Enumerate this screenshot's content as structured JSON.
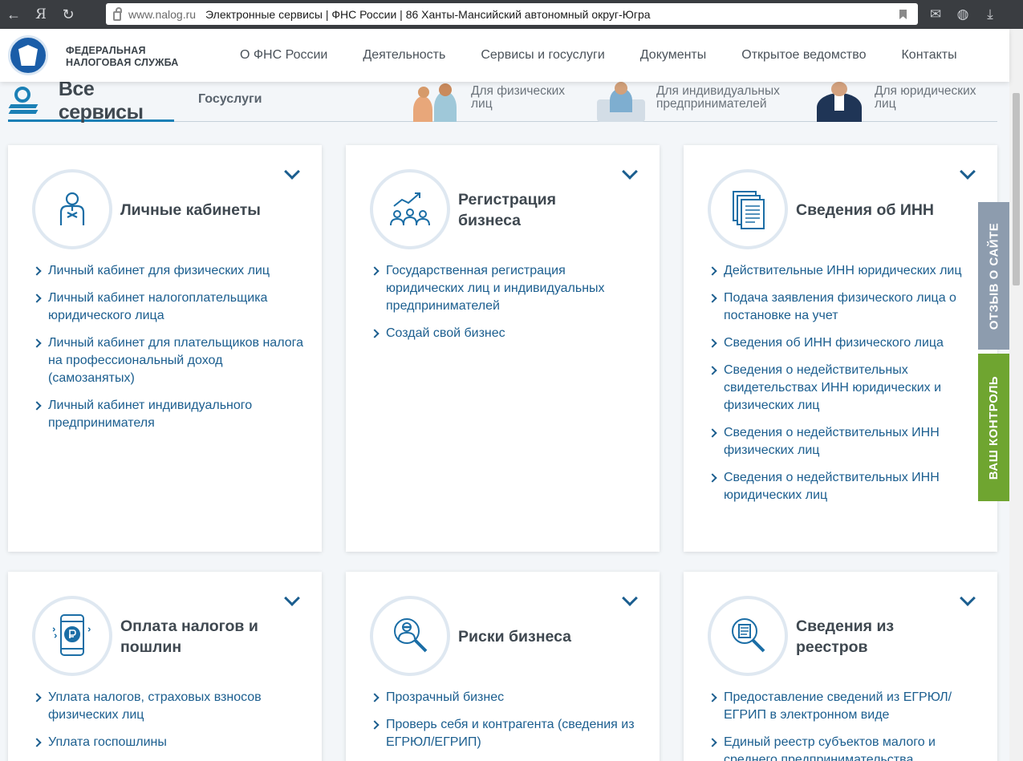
{
  "browser": {
    "back": "←",
    "yandex": "Я",
    "reload": "↻",
    "url_domain": "www.nalog.ru",
    "page_title": "Электронные сервисы | ФНС России | 86 Ханты-Мансийский автономный округ-Югра"
  },
  "header": {
    "logo_line1": "ФЕДЕРАЛЬНАЯ",
    "logo_line2": "НАЛОГОВАЯ СЛУЖБА",
    "nav": [
      "О ФНС России",
      "Деятельность",
      "Сервисы и госуслуги",
      "Документы",
      "Открытое ведомство",
      "Контакты"
    ]
  },
  "tabs": {
    "all_services": "Все сервисы",
    "gosuslugi": "Госуслуги",
    "audience": [
      {
        "line1": "Для физических",
        "line2": "лиц"
      },
      {
        "line1": "Для индивидуальных",
        "line2": "предпринимателей"
      },
      {
        "line1": "Для юридических",
        "line2": "лиц"
      }
    ]
  },
  "cards": [
    {
      "title_lines": [
        "Личные кабинеты"
      ],
      "links": [
        "Личный кабинет для физических лиц",
        "Личный кабинет налогоплательщика юридического лица",
        "Личный кабинет для плательщиков налога на профессиональный доход (самозанятых)",
        "Личный кабинет индивидуального предпринимателя"
      ]
    },
    {
      "title_lines": [
        "Регистрация",
        "бизнеса"
      ],
      "links": [
        "Государственная регистрация юридических лиц и индивидуальных предпринимателей",
        "Создай свой бизнес"
      ]
    },
    {
      "title_lines": [
        "Сведения об ИНН"
      ],
      "links": [
        "Действительные ИНН юридических лиц",
        "Подача заявления физического лица о постановке на учет",
        "Сведения об ИНН физического лица",
        "Сведения о недействительных свидетельствах ИНН юридических и физических лиц",
        "Сведения о недействительных ИНН физических лиц",
        "Сведения о недействительных ИНН юридических лиц"
      ]
    },
    {
      "title_lines": [
        "Оплата налогов и",
        "пошлин"
      ],
      "links": [
        "Уплата налогов, страховых взносов физических лиц",
        "Уплата госпошлины"
      ]
    },
    {
      "title_lines": [
        "Риски бизнеса"
      ],
      "links": [
        "Прозрачный бизнес",
        "Проверь себя и контрагента (сведения из ЕГРЮЛ/ЕГРИП)"
      ]
    },
    {
      "title_lines": [
        "Сведения из",
        "реестров"
      ],
      "links": [
        "Предоставление сведений из ЕГРЮЛ/ЕГРИП в электронном виде",
        "Единый реестр субъектов малого и среднего предпринимательства"
      ]
    }
  ],
  "side_tabs": {
    "feedback": "ОТЗЫВ О САЙТЕ",
    "control": "ВАШ КОНТРОЛЬ"
  },
  "colors": {
    "link": "#1b5e8f",
    "accent": "#1b80b6",
    "feedback_tab": "#8d9cae",
    "control_tab": "#6fa530"
  }
}
